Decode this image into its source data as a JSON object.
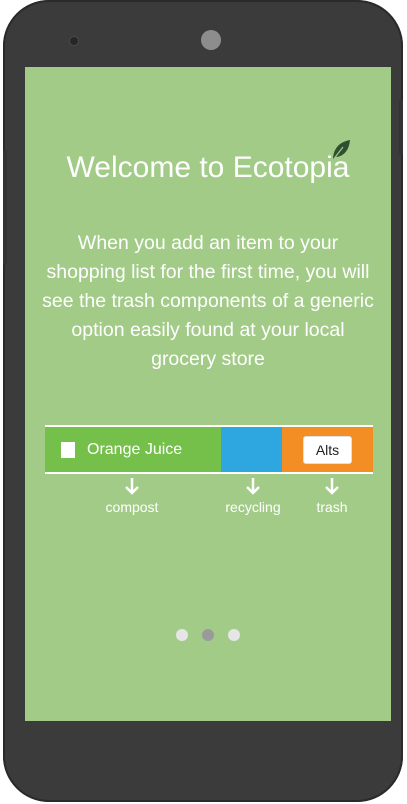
{
  "app": {
    "title": "Welcome to Ecotopia",
    "intro": "When you add an item to your shopping list for the first time, you will see the trash components of a generic option easily found at your local grocery store"
  },
  "example_item": {
    "name": "Orange Juice",
    "alts_label": "Alts",
    "segments": [
      {
        "category": "compost",
        "color": "#75c04b"
      },
      {
        "category": "recycling",
        "color": "#2ea7e0"
      },
      {
        "category": "trash",
        "color": "#f28e23"
      }
    ]
  },
  "categories": {
    "compost": "compost",
    "recycling": "recycling",
    "trash": "trash"
  },
  "pager": {
    "page_count": 3,
    "active_index": 1
  },
  "colors": {
    "background": "#a2cb88",
    "phone_body": "#3b3b3b",
    "text": "#ffffff"
  }
}
